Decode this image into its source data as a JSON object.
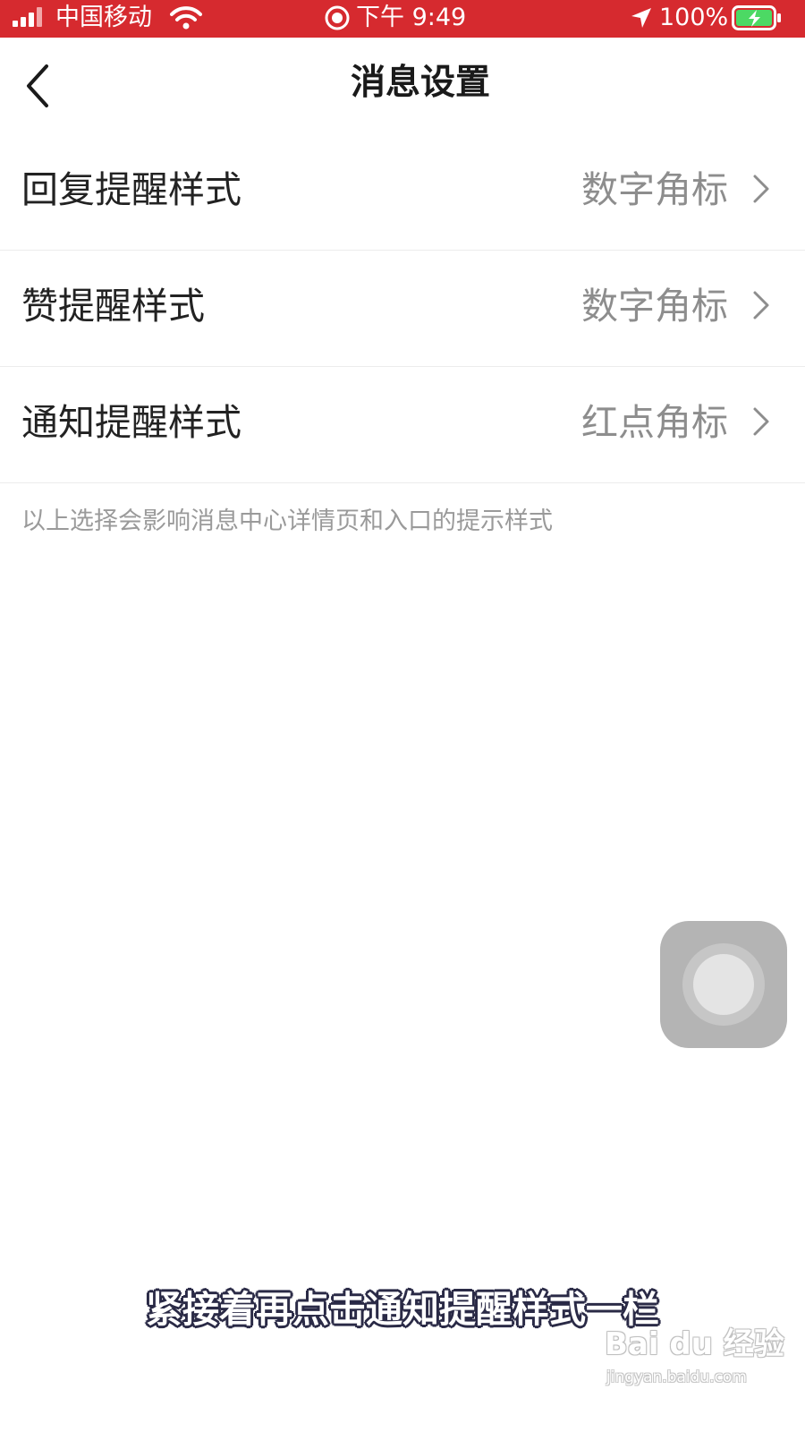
{
  "status_bar": {
    "carrier": "中国移动",
    "time": "下午 9:49",
    "battery_percent": "100%",
    "background_color": "#d62a2f"
  },
  "nav": {
    "title": "消息设置",
    "back_icon": "chevron-left-icon"
  },
  "settings": [
    {
      "label": "回复提醒样式",
      "value": "数字角标"
    },
    {
      "label": "赞提醒样式",
      "value": "数字角标"
    },
    {
      "label": "通知提醒样式",
      "value": "红点角标"
    }
  ],
  "hint": "以上选择会影响消息中心详情页和入口的提示样式",
  "caption": "紧接着再点击通知提醒样式一栏",
  "watermark": {
    "brand": "Bai du 经验",
    "url": "jingyan.baidu.com"
  }
}
